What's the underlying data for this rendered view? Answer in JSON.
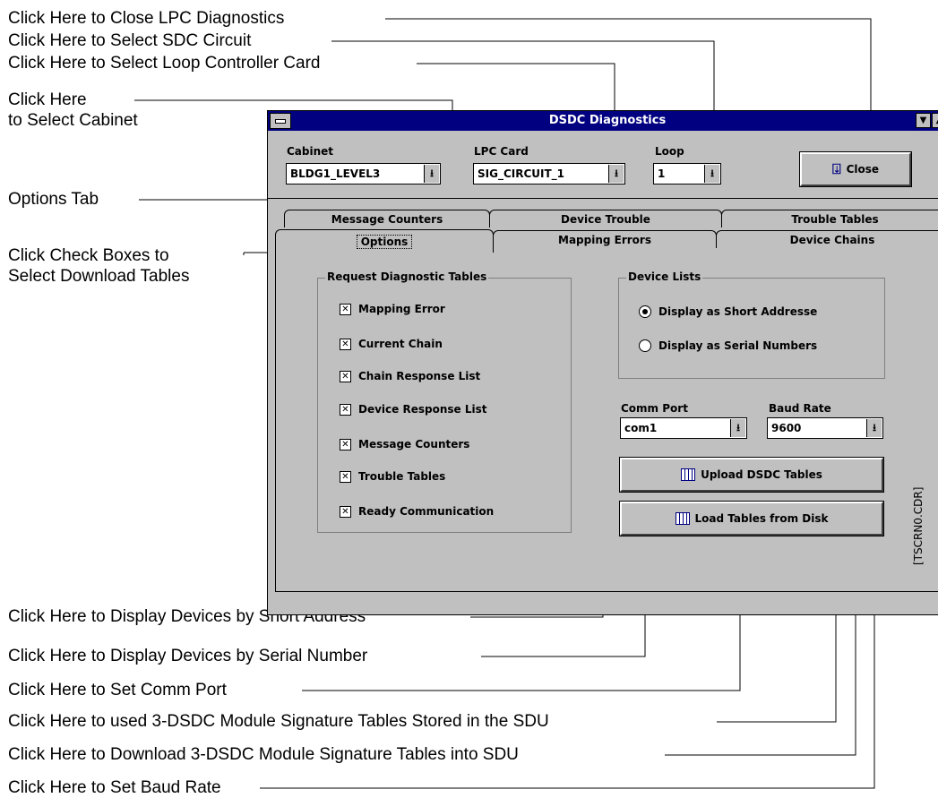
{
  "callouts": {
    "close_lpc": "Click Here to Close LPC Diagnostics",
    "select_sdc": "Click Here to Select SDC Circuit",
    "select_loop_card": "Click Here to Select Loop Controller Card",
    "select_cabinet_1": "Click Here",
    "select_cabinet_2": "to Select Cabinet",
    "options_tab": "Options Tab",
    "check_boxes_1": "Click Check Boxes to",
    "check_boxes_2": "Select Download Tables",
    "short_address": "Click Here to Display Devices by Short Address",
    "serial_number": "Click Here to Display Devices by Serial Number",
    "comm_port": "Click Here to Set Comm Port",
    "used_tables": "Click Here to used 3-DSDC Module Signature Tables Stored in the SDU",
    "download_tables": "Click Here to Download 3-DSDC Module Signature Tables into SDU",
    "baud_rate": "Click Here to Set Baud Rate"
  },
  "window": {
    "title": "DSDC Diagnostics",
    "cabinet": {
      "label": "Cabinet",
      "value": "BLDG1_LEVEL3"
    },
    "lpc_card": {
      "label": "LPC Card",
      "value": "SIG_CIRCUIT_1"
    },
    "loop": {
      "label": "Loop",
      "value": "1"
    },
    "close_button": "Close",
    "tabs_back": [
      "Message Counters",
      "Device Trouble",
      "Trouble Tables"
    ],
    "tabs_front": [
      "Options",
      "Mapping Errors",
      "Device Chains"
    ],
    "request_group": {
      "title": "Request Diagnostic Tables",
      "items": [
        "Mapping Error",
        "Current Chain",
        "Chain Response List",
        "Device Response List",
        "Message Counters",
        "Trouble Tables",
        "Ready Communication"
      ]
    },
    "device_lists": {
      "title": "Device Lists",
      "short": "Display as Short Addresse",
      "serial": "Display as Serial Numbers"
    },
    "comm_port": {
      "label": "Comm Port",
      "value": "com1"
    },
    "baud_rate": {
      "label": "Baud Rate",
      "value": "9600"
    },
    "upload_button": "Upload DSDC Tables",
    "load_button": "Load Tables from Disk",
    "file_tag": "[TSCRN0.CDR]"
  }
}
